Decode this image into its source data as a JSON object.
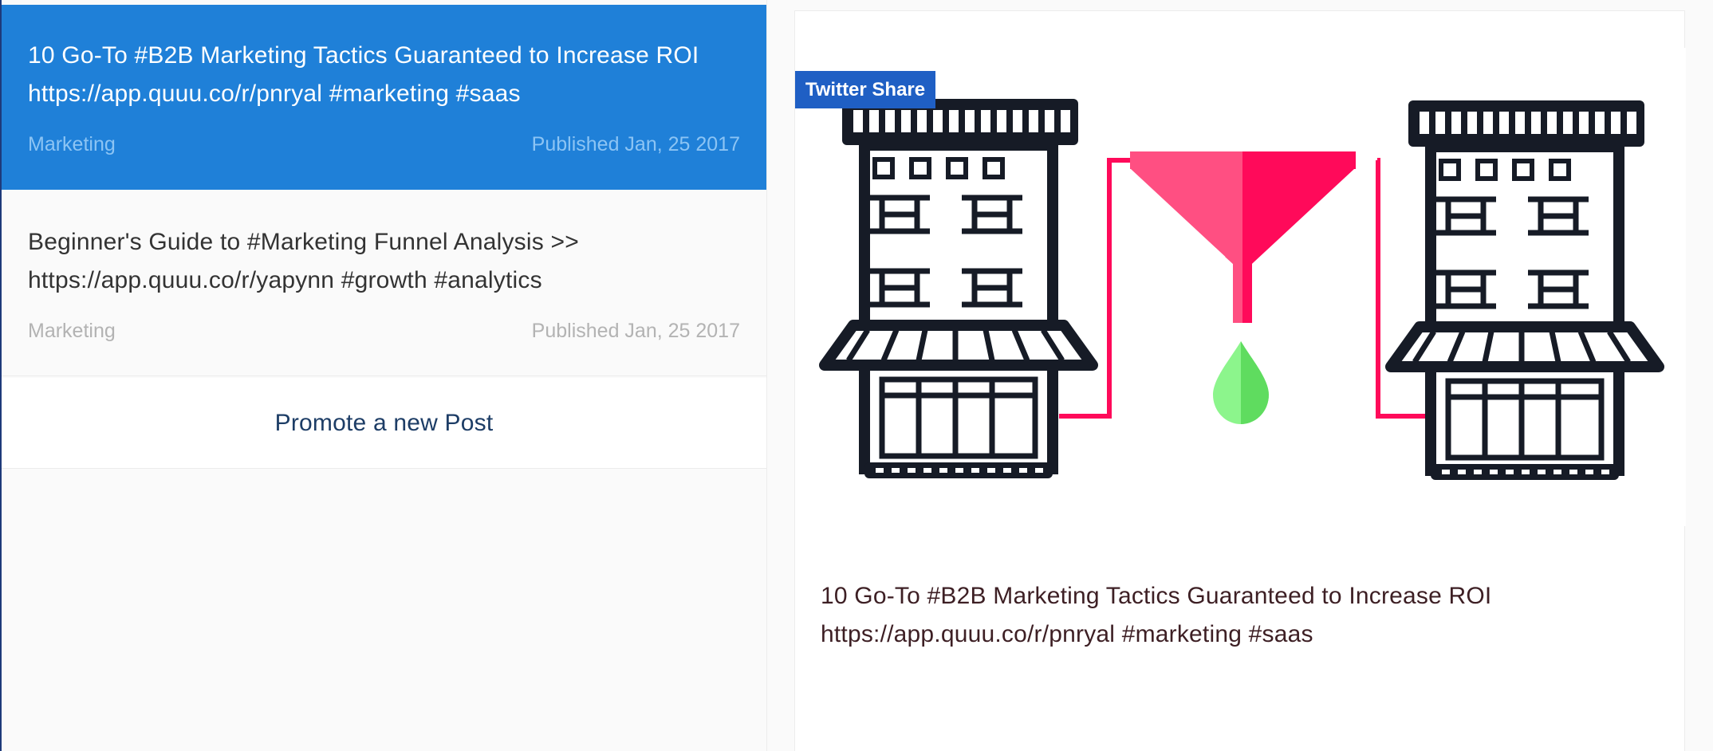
{
  "posts": [
    {
      "text": "10 Go-To #B2B Marketing Tactics Guaranteed to Increase ROI\nhttps://app.quuu.co/r/pnryal #marketing #saas",
      "category": "Marketing",
      "published": "Published Jan, 25 2017",
      "selected": true
    },
    {
      "text": "Beginner's Guide to #Marketing Funnel Analysis >>\nhttps://app.quuu.co/r/yapynn #growth #analytics",
      "category": "Marketing",
      "published": "Published Jan, 25 2017",
      "selected": false
    }
  ],
  "promote_label": "Promote a new Post",
  "preview": {
    "badge": "Twitter Share",
    "text": "10 Go-To #B2B Marketing Tactics Guaranteed to Increase ROI\nhttps://app.quuu.co/r/pnryal #marketing #saas",
    "image_icon": "marketing-funnel-illustration"
  },
  "colors": {
    "selected_bg": "#1f80d8",
    "badge_bg": "#1f5fc4",
    "funnel_pink": "#ff0a5a",
    "funnel_light": "#ff4f82",
    "drop_green": "#8cf58c",
    "building": "#161b26"
  }
}
